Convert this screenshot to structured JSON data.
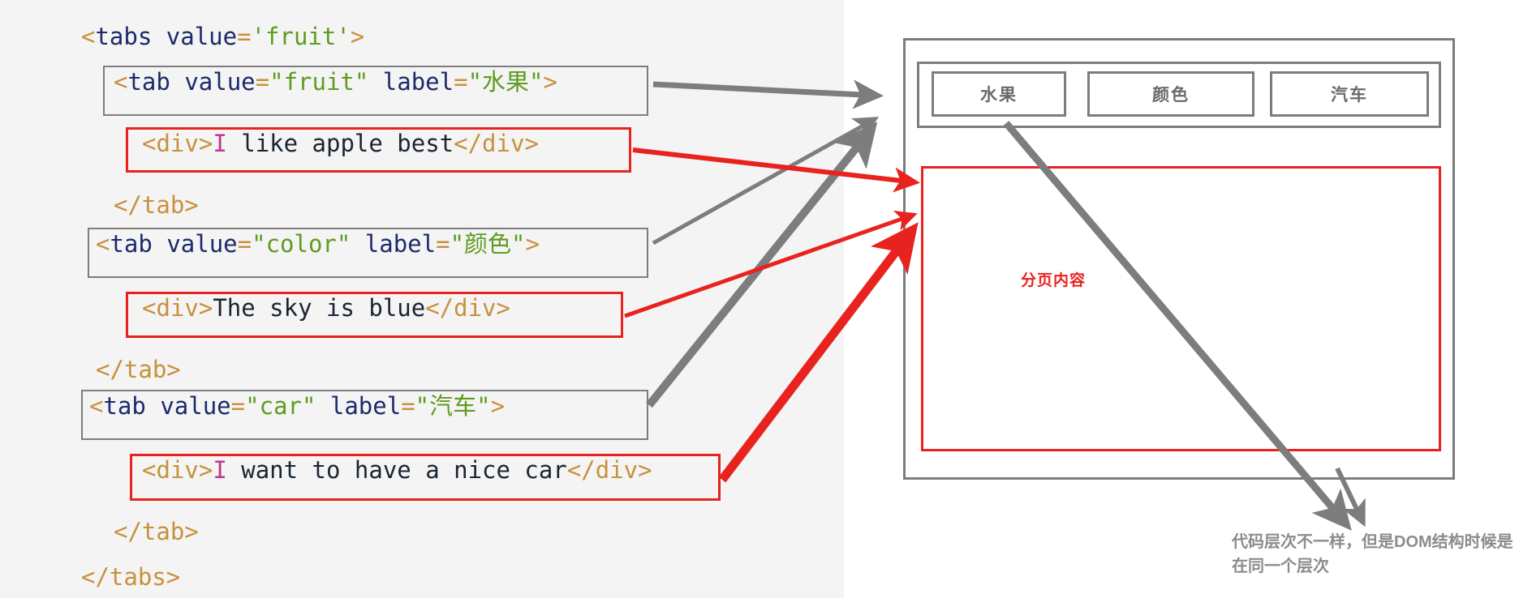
{
  "code": {
    "lines": [
      {
        "indent": 0,
        "tokens": [
          {
            "t": "<",
            "c": "punct"
          },
          {
            "t": "tabs",
            "c": "tag"
          },
          {
            "t": " ",
            "c": "text"
          },
          {
            "t": "value",
            "c": "attr"
          },
          {
            "t": "=",
            "c": "eq"
          },
          {
            "t": "'fruit'",
            "c": "str"
          },
          {
            "t": ">",
            "c": "punct"
          }
        ]
      },
      {
        "indent": 1,
        "tokens": [
          {
            "t": "<",
            "c": "punct"
          },
          {
            "t": "tab",
            "c": "tag"
          },
          {
            "t": " ",
            "c": "text"
          },
          {
            "t": "value",
            "c": "attr"
          },
          {
            "t": "=",
            "c": "eq"
          },
          {
            "t": "\"fruit\"",
            "c": "str"
          },
          {
            "t": " ",
            "c": "text"
          },
          {
            "t": "label",
            "c": "attr"
          },
          {
            "t": "=",
            "c": "eq"
          },
          {
            "t": "\"水果\"",
            "c": "str"
          },
          {
            "t": ">",
            "c": "punct"
          }
        ]
      },
      {
        "indent": 2,
        "tokens": [
          {
            "t": "<div>",
            "c": "punct"
          },
          {
            "t": "I",
            "c": "i"
          },
          {
            "t": " like apple best",
            "c": "text"
          },
          {
            "t": "</div>",
            "c": "punct"
          }
        ]
      },
      {
        "indent": 1,
        "tokens": [
          {
            "t": "</tab>",
            "c": "punct"
          }
        ]
      },
      {
        "indent": 1,
        "tokens": [
          {
            "t": "<",
            "c": "punct"
          },
          {
            "t": "tab",
            "c": "tag"
          },
          {
            "t": " ",
            "c": "text"
          },
          {
            "t": "value",
            "c": "attr"
          },
          {
            "t": "=",
            "c": "eq"
          },
          {
            "t": "\"color\"",
            "c": "str"
          },
          {
            "t": " ",
            "c": "text"
          },
          {
            "t": "label",
            "c": "attr"
          },
          {
            "t": "=",
            "c": "eq"
          },
          {
            "t": "\"颜色\"",
            "c": "str"
          },
          {
            "t": ">",
            "c": "punct"
          }
        ]
      },
      {
        "indent": 2,
        "tokens": [
          {
            "t": "<div>",
            "c": "punct"
          },
          {
            "t": "The sky is blue",
            "c": "text"
          },
          {
            "t": "</div>",
            "c": "punct"
          }
        ]
      },
      {
        "indent": 1,
        "tokens": [
          {
            "t": "</tab>",
            "c": "punct"
          }
        ]
      },
      {
        "indent": 1,
        "tokens": [
          {
            "t": "<",
            "c": "punct"
          },
          {
            "t": "tab",
            "c": "tag"
          },
          {
            "t": " ",
            "c": "text"
          },
          {
            "t": "value",
            "c": "attr"
          },
          {
            "t": "=",
            "c": "eq"
          },
          {
            "t": "\"car\"",
            "c": "str"
          },
          {
            "t": " ",
            "c": "text"
          },
          {
            "t": "label",
            "c": "attr"
          },
          {
            "t": "=",
            "c": "eq"
          },
          {
            "t": "\"汽车\"",
            "c": "str"
          },
          {
            "t": ">",
            "c": "punct"
          }
        ]
      },
      {
        "indent": 2,
        "tokens": [
          {
            "t": "<div>",
            "c": "punct"
          },
          {
            "t": "I",
            "c": "i"
          },
          {
            "t": " want to have a nice car",
            "c": "text"
          },
          {
            "t": "</div>",
            "c": "punct"
          }
        ]
      },
      {
        "indent": 1,
        "tokens": [
          {
            "t": "</tab>",
            "c": "punct"
          }
        ]
      },
      {
        "indent": 0,
        "tokens": [
          {
            "t": "</tabs>",
            "c": "punct"
          }
        ]
      }
    ],
    "line_texts": [
      "<tabs value='fruit'>",
      "<tab value=\"fruit\" label=\"水果\">",
      "<div>I like apple best</div>",
      "</tab>",
      "<tab value=\"color\" label=\"颜色\">",
      "<div>The sky is blue</div>",
      "</tab>",
      "<tab value=\"car\" label=\"汽车\">",
      "<div>I want to have a nice car</div>",
      "</tab>",
      "</tabs>"
    ]
  },
  "mock": {
    "tabs": [
      {
        "label": "水果",
        "value": "fruit"
      },
      {
        "label": "颜色",
        "value": "color"
      },
      {
        "label": "汽车",
        "value": "car"
      }
    ],
    "content_label": "分页内容"
  },
  "caption": {
    "text": "代码层次不一样，但是DOM结构时候是在同一个层次"
  },
  "colors": {
    "code_bg": "#f4f4f4",
    "gray_box": "#7d7d7d",
    "red_box": "#e8231f",
    "gray_arrow": "#7d7d7d",
    "red_arrow": "#e8231f",
    "string": "#5f9b20",
    "tag": "#1b2a6b",
    "punct": "#c8913c",
    "caption": "#8c8c8c"
  }
}
